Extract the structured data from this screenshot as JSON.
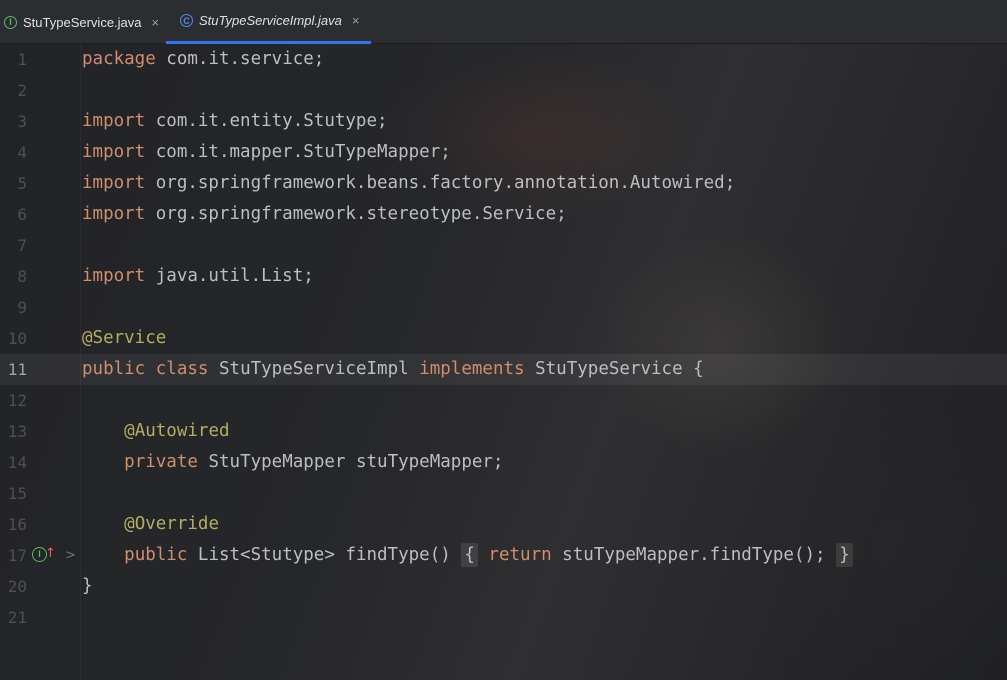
{
  "tabs": [
    {
      "label": "StuTypeService.java",
      "icon": "interface-icon",
      "icon_glyph": "I",
      "close": "×"
    },
    {
      "label": "StuTypeServiceImpl.java",
      "icon": "class-icon",
      "icon_glyph": "C",
      "close": "×",
      "active": true
    }
  ],
  "editor": {
    "current_line": "11",
    "lines": [
      {
        "num": "1",
        "kw1": "package",
        "text": " com.it.service;"
      },
      {
        "num": "2"
      },
      {
        "num": "3",
        "kw1": "import",
        "text": " com.it.entity.Stutype;"
      },
      {
        "num": "4",
        "kw1": "import",
        "text": " com.it.mapper.StuTypeMapper;"
      },
      {
        "num": "5",
        "kw1": "import",
        "text": " org.springframework.beans.factory.annotation.Autowired;"
      },
      {
        "num": "6",
        "kw1": "import",
        "text": " org.springframework.stereotype.Service;"
      },
      {
        "num": "7"
      },
      {
        "num": "8",
        "kw1": "import",
        "text": " java.util.List;"
      },
      {
        "num": "9"
      },
      {
        "num": "10",
        "annotation": "@Service"
      },
      {
        "num": "11",
        "kw1": "public",
        "kw2": "class",
        "class_name": "StuTypeServiceImpl",
        "kw3": "implements",
        "text": " StuTypeService {"
      },
      {
        "num": "12"
      },
      {
        "num": "13",
        "annotation": "@Autowired"
      },
      {
        "num": "14",
        "kw1": "private",
        "text": " StuTypeMapper stuTypeMapper;"
      },
      {
        "num": "15"
      },
      {
        "num": "16",
        "annotation": "@Override"
      },
      {
        "num": "17",
        "kw1": "public",
        "text": " List<Stutype> findType()",
        "brace_open": "{",
        "kw2": "return",
        "text2": " stuTypeMapper.findType();",
        "brace_close": "}",
        "gutter_glyph": "I",
        "gutter_arrow": "↑",
        "fold": ">"
      },
      {
        "num": "20",
        "text": "}"
      },
      {
        "num": "21"
      }
    ]
  }
}
